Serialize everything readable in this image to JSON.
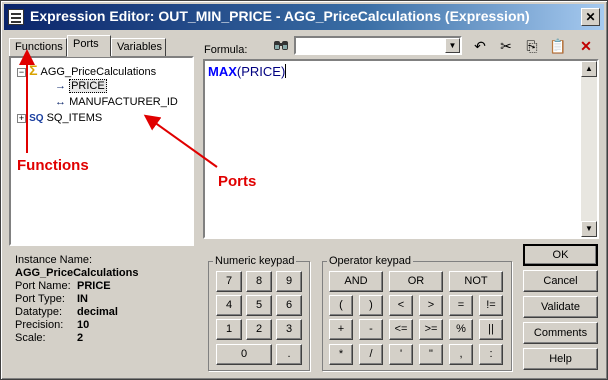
{
  "window": {
    "title": "Expression Editor: OUT_MIN_PRICE - AGG_PriceCalculations (Expression)",
    "close_glyph": "✕"
  },
  "tabs": [
    "Functions",
    "Ports",
    "Variables"
  ],
  "active_tab": "Ports",
  "tree": {
    "root": "AGG_PriceCalculations",
    "children": [
      "PRICE",
      "MANUFACTURER_ID"
    ],
    "sibling": "SQ_ITEMS",
    "sibling_badge": "SQ"
  },
  "info": {
    "instance_label": "Instance Name:",
    "instance_value": "AGG_PriceCalculations",
    "rows": [
      {
        "key": "Port Name:",
        "value": "PRICE"
      },
      {
        "key": "Port Type:",
        "value": "IN"
      },
      {
        "key": "Datatype:",
        "value": "decimal"
      },
      {
        "key": "Precision:",
        "value": "10"
      },
      {
        "key": "Scale:",
        "value": "2"
      }
    ]
  },
  "formula": {
    "label": "Formula:",
    "search_value": "",
    "function_name": "MAX",
    "args": "(PRICE)"
  },
  "numeric_keypad": {
    "legend": "Numeric keypad",
    "keys": [
      "7",
      "8",
      "9",
      "4",
      "5",
      "6",
      "1",
      "2",
      "3",
      "0",
      "."
    ]
  },
  "operator_keypad": {
    "legend": "Operator keypad",
    "row1": [
      "AND",
      "OR",
      "NOT"
    ],
    "keys": [
      "(",
      ")",
      "<",
      ">",
      "=",
      "!=",
      "+",
      "-",
      "<=",
      ">=",
      "%",
      "||",
      "*",
      "/",
      "'",
      "\"",
      ",",
      ":"
    ]
  },
  "buttons": {
    "ok": "OK",
    "cancel": "Cancel",
    "validate": "Validate",
    "comments": "Comments",
    "help": "Help"
  },
  "annotations": {
    "functions": "Functions",
    "ports": "Ports",
    "color": "#e00000"
  }
}
